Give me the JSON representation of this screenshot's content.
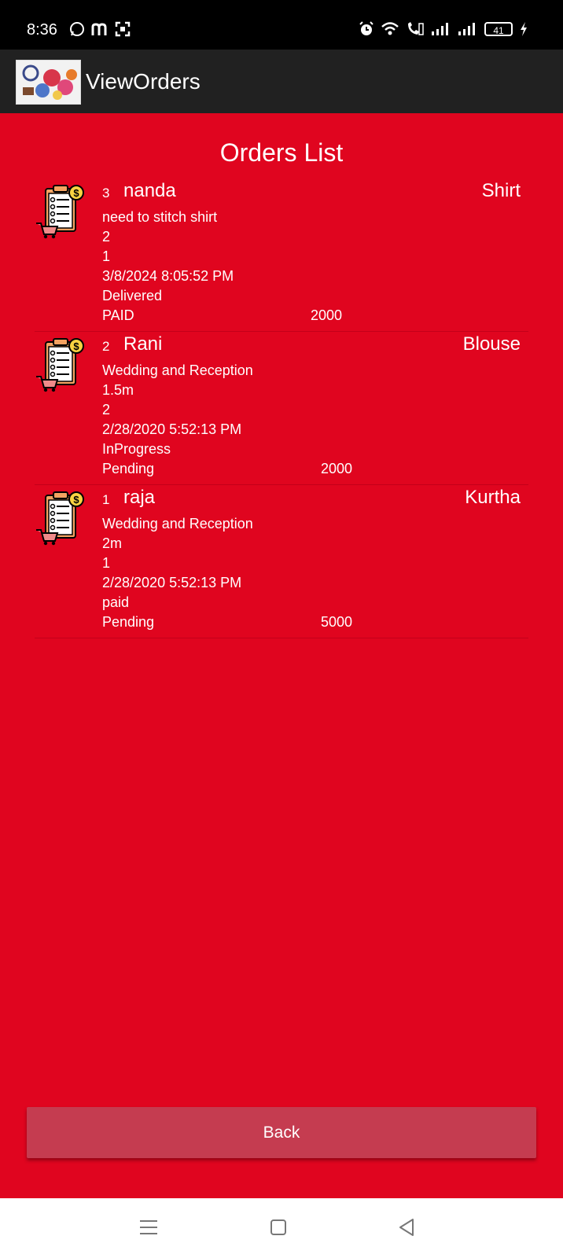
{
  "status_bar": {
    "time": "8:36",
    "battery": "41",
    "left_icons": [
      "whatsapp-icon",
      "m-app-icon",
      "scan-icon"
    ],
    "right_icons": [
      "alarm-icon",
      "wifi-icon",
      "volte-call-icon",
      "signal-icon",
      "signal-icon",
      "battery-icon",
      "charging-icon"
    ]
  },
  "app_bar": {
    "title": "ViewOrders"
  },
  "orders_list": {
    "title": "Orders List",
    "orders": [
      {
        "num": "3",
        "name": "nanda",
        "item": "Shirt",
        "description": "need to stitch shirt",
        "size": "2",
        "quantity": "1",
        "date": "3/8/2024 8:05:52 PM",
        "status": "Delivered",
        "payment": "PAID",
        "amount": "2000"
      },
      {
        "num": "2",
        "name": "Rani",
        "item": "Blouse",
        "description": "Wedding and Reception",
        "size": "1.5m",
        "quantity": "2",
        "date": "2/28/2020 5:52:13 PM",
        "status": "InProgress",
        "payment": "Pending",
        "amount": "2000"
      },
      {
        "num": "1",
        "name": "raja",
        "item": "Kurtha",
        "description": "Wedding and Reception",
        "size": "2m",
        "quantity": "1",
        "date": "2/28/2020 5:52:13 PM",
        "status": "paid",
        "payment": "Pending",
        "amount": "5000"
      }
    ]
  },
  "back_button": {
    "label": "Back"
  },
  "nav_bar": {
    "buttons": [
      "menu-icon",
      "home-icon",
      "back-icon"
    ]
  },
  "colors": {
    "background": "#e0051f",
    "app_bar": "#212121",
    "button": "#c53c50"
  }
}
